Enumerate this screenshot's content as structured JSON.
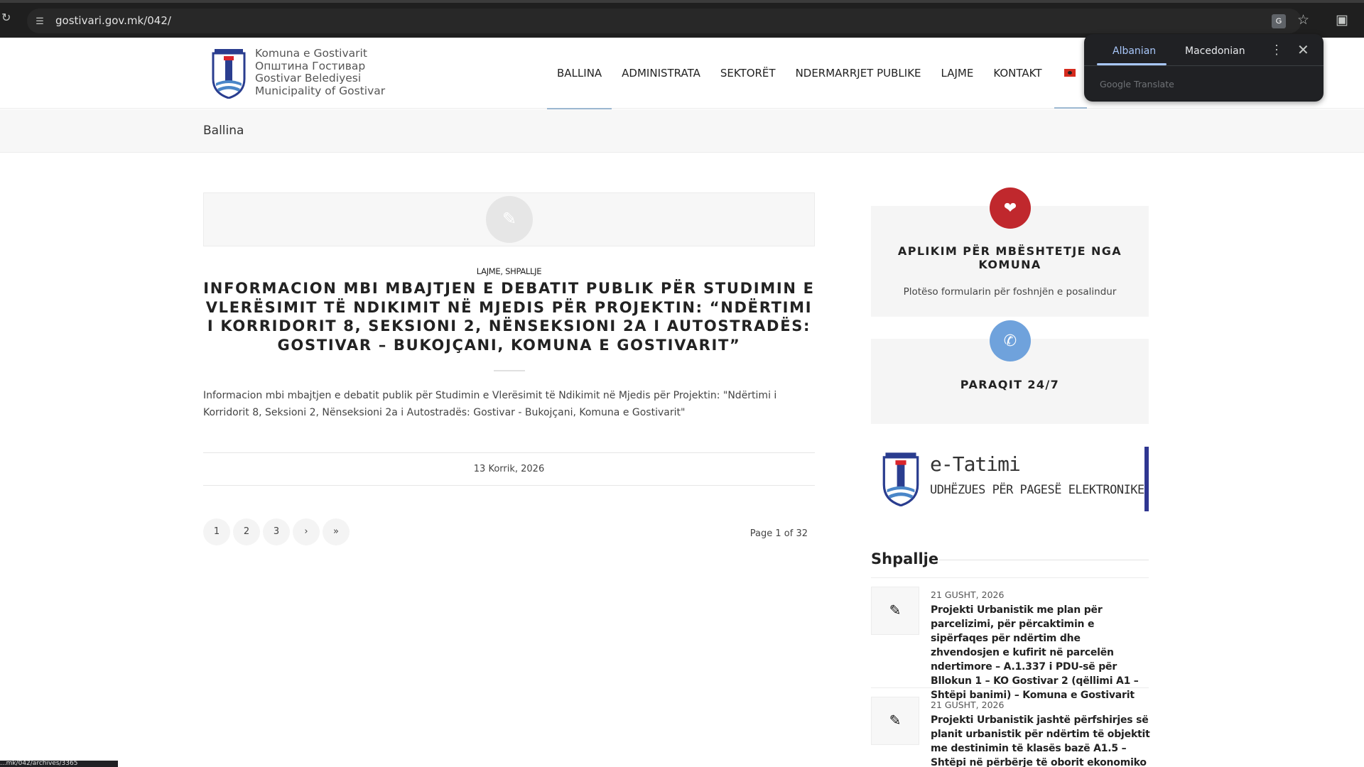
{
  "browser": {
    "url": "gostivari.gov.mk/042/",
    "status_url": "...mk/042/archives/3365"
  },
  "translate_popup": {
    "lang_source": "Albanian",
    "lang_target": "Macedonian",
    "brand": "Google Translate"
  },
  "header": {
    "logo_lines": [
      "Komuna e Gostivarit",
      "Општина Гостивар",
      "Gostivar Belediyesi",
      "Municipality of Gostivar"
    ],
    "nav": [
      "BALLINA",
      "ADMINISTRATA",
      "SEKTORËT",
      "NDERMARRJET PUBLIKE",
      "LAJME",
      "KONTAKT"
    ]
  },
  "breadcrumb": "Ballina",
  "post": {
    "categories": "LAJME, SHPALLJE",
    "title": "INFORMACION MBI MBAJTJEN E DEBATIT PUBLIK PËR STUDIMIN E VLERËSIMIT TË NDIKIMIT NË MJEDIS PËR PROJEKTIN: “NDËRTIMI I KORRIDORIT 8, SEKSIONI 2, NËNSEKSIONI 2A I AUTOSTRADËS: GOSTIVAR – BUKOJÇANI, KOMUNA E GOSTIVARIT”",
    "excerpt": "Informacion mbi mbajtjen e debatit publik për Studimin e Vlerësimit të Ndikimit në Mjedis për Projektin: \"Ndërtimi i Korridorit 8, Seksioni 2, Nënseksioni 2a i Autostradës: Gostivar - Bukojçani, Komuna e Gostivarit\"",
    "date": "13 Korrik, 2026"
  },
  "pagination": {
    "pages": [
      "1",
      "2",
      "3",
      "›",
      "»"
    ],
    "page_of": "Page 1 of 32"
  },
  "sidebar": {
    "card1_title": "APLIKIM PËR MBËSHTETJE NGA KOMUNA",
    "card1_sub": "Plotëso formularin për foshnjën e posalindur",
    "card2_title": "PARAQIT 24/7",
    "etatimi_title": "e-Tatimi",
    "etatimi_sub": "UDHËZUES PËR PAGESË ELEKTRONIKE",
    "shpallje_title": "Shpallje",
    "announcements": [
      {
        "date": "21 GUSHT, 2026",
        "title": "Projekti Urbanistik me plan për parcelizimi, për përcaktimin e sipërfaqes për ndërtim dhe zhvendosjen e kufirit në parcelën ndertimore – A.1.337 i PDU-së për Bllokun 1 – KO Gostivar 2 (qëllimi A1 – Shtëpi banimi) – Komuna e Gostivarit"
      },
      {
        "date": "21 GUSHT, 2026",
        "title": "Projekti Urbanistik jashtë përfshirjes së planit urbanistik për ndërtim të objektit me destinimin të klasës bazë A1.5 – Shtëpi në përbërje të oborit ekonomiko fshataresk në"
      }
    ]
  },
  "colors": {
    "heart_circle": "#c0282d",
    "phone_circle": "#6fa2dc",
    "etatimi_accent": "#2f3691",
    "nav_active_underline": "#9bb7d0"
  }
}
